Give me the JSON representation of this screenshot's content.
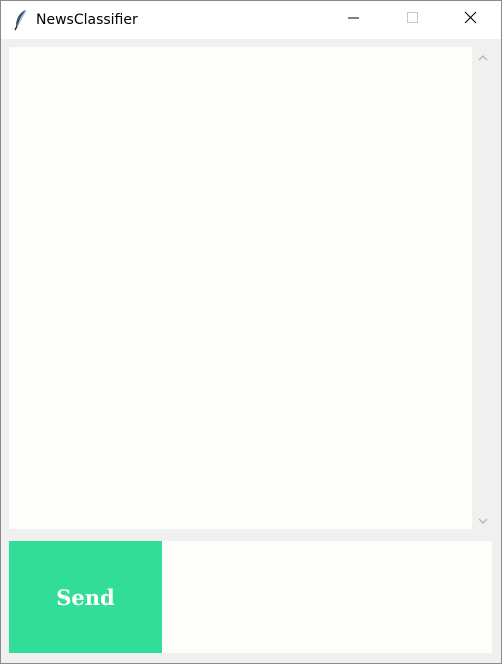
{
  "window": {
    "title": "NewsClassifier",
    "icon": "feather-icon",
    "controls": [
      "minimize-icon",
      "maximize-icon",
      "close-icon"
    ]
  },
  "chat_log": {
    "messages": [],
    "scrollbar": {
      "up_icon": "chevron-up-icon",
      "down_icon": "chevron-down-icon"
    }
  },
  "composer": {
    "send_label": "Send",
    "entry_value": ""
  },
  "colors": {
    "send_button": "#32de97",
    "send_text": "#ffffff",
    "chat_background": "#fdfdfa",
    "window_background": "#f0f0f0"
  }
}
